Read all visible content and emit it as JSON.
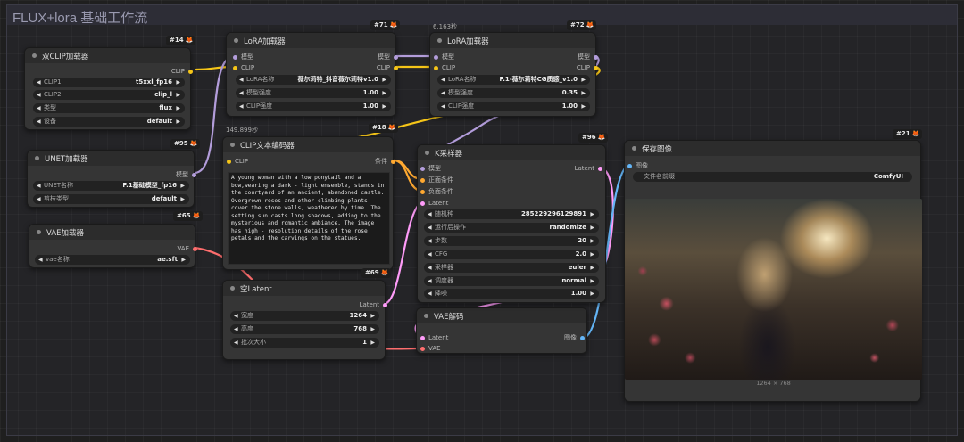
{
  "workflow_title": "FLUX+lora 基础工作流",
  "nodes": {
    "dual_clip": {
      "badge": "#14",
      "title": "双CLIP加载器",
      "out": "CLIP",
      "widgets": [
        {
          "label": "CLIP1",
          "value": "t5xxl_fp16"
        },
        {
          "label": "CLIP2",
          "value": "clip_l"
        },
        {
          "label": "类型",
          "value": "flux"
        },
        {
          "label": "设备",
          "value": "default"
        }
      ]
    },
    "unet": {
      "badge": "#95",
      "title": "UNET加载器",
      "out": "模型",
      "widgets": [
        {
          "label": "UNET名称",
          "value": "F.1基础模型_fp16"
        },
        {
          "label": "剪枝类型",
          "value": "default"
        }
      ]
    },
    "vae_loader": {
      "badge": "#65",
      "title": "VAE加载器",
      "out": "VAE",
      "widgets": [
        {
          "label": "vae名称",
          "value": "ae.sft"
        }
      ]
    },
    "lora1": {
      "badge": "#71",
      "title": "LoRA加载器",
      "in": [
        "模型",
        "CLIP"
      ],
      "out": [
        "模型",
        "CLIP"
      ],
      "widgets": [
        {
          "label": "LoRA名称",
          "value": "薇尔莉特_抖音薇尔莉特v1.0"
        },
        {
          "label": "模型强度",
          "value": "1.00"
        },
        {
          "label": "CLIP强度",
          "value": "1.00"
        }
      ]
    },
    "lora2": {
      "badge": "#72",
      "stat": "6.163秒",
      "title": "LoRA加载器",
      "in": [
        "模型",
        "CLIP"
      ],
      "out": [
        "模型",
        "CLIP"
      ],
      "widgets": [
        {
          "label": "LoRA名称",
          "value": "F.1-薇尔莉特CG质感_v1.0"
        },
        {
          "label": "模型强度",
          "value": "0.35"
        },
        {
          "label": "CLIP强度",
          "value": "1.00"
        }
      ]
    },
    "clip_text": {
      "badge": "#18",
      "stat": "149.899秒",
      "title": "CLIP文本编码器",
      "in": "CLIP",
      "out": "条件",
      "prompt": "A young woman with a low ponytail and a bow,wearing a dark - light ensemble, stands in the courtyard of an ancient, abandoned castle. Overgrown roses and other climbing plants cover the stone walls, weathered by time. The setting sun casts long shadows, adding to the mysterious and romantic ambiance. The image has high - resolution details of the rose petals and the carvings on the statues."
    },
    "empty_latent": {
      "badge": "#69",
      "title": "空Latent",
      "out": "Latent",
      "widgets": [
        {
          "label": "宽度",
          "value": "1264"
        },
        {
          "label": "高度",
          "value": "768"
        },
        {
          "label": "批次大小",
          "value": "1"
        }
      ]
    },
    "ksampler": {
      "badge": "#96",
      "title": "K采样器",
      "in": [
        "模型",
        "正面条件",
        "负面条件",
        "Latent"
      ],
      "out": "Latent",
      "widgets": [
        {
          "label": "随机种",
          "value": "285229296129891"
        },
        {
          "label": "运行后操作",
          "value": "randomize"
        },
        {
          "label": "步数",
          "value": "20"
        },
        {
          "label": "CFG",
          "value": "2.0"
        },
        {
          "label": "采样器",
          "value": "euler"
        },
        {
          "label": "调度器",
          "value": "normal"
        },
        {
          "label": "降噪",
          "value": "1.00"
        }
      ]
    },
    "vae_decode": {
      "title": "VAE解码",
      "in": [
        "Latent",
        "VAE"
      ],
      "out": "图像"
    },
    "save_image": {
      "badge": "#21",
      "title": "保存图像",
      "in": "图像",
      "widgets": [
        {
          "label": "文件名前缀",
          "value": "ComfyUI"
        }
      ],
      "caption": "1264 × 768"
    }
  },
  "colors": {
    "clip": "#f5c518",
    "model": "#b39ddb",
    "conditioning": "#ffa931",
    "latent": "#ff9cf9",
    "vae": "#ff6e6e",
    "image": "#64b5f6"
  },
  "icons": {
    "badge": "fox-icon",
    "arrows": [
      "arrow-left-icon",
      "arrow-right-icon"
    ]
  }
}
